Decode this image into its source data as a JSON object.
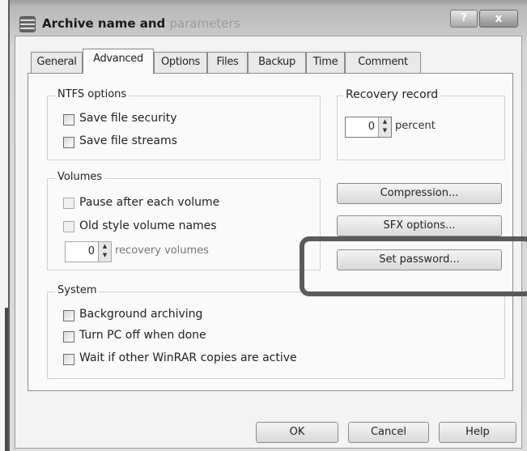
{
  "window": {
    "title_main": "Archive name and",
    "title_faded": "parameters",
    "help_label": "?",
    "close_label": "x"
  },
  "tabs": [
    {
      "label": "General",
      "active": false
    },
    {
      "label": "Advanced",
      "active": true
    },
    {
      "label": "Options",
      "active": false
    },
    {
      "label": "Files",
      "active": false
    },
    {
      "label": "Backup",
      "active": false
    },
    {
      "label": "Time",
      "active": false
    },
    {
      "label": "Comment",
      "active": false
    }
  ],
  "ntfs": {
    "title": "NTFS options",
    "options": [
      {
        "label": "Save file security",
        "checked": false
      },
      {
        "label": "Save file streams",
        "checked": false
      }
    ]
  },
  "recovery": {
    "title": "Recovery record",
    "value": "0",
    "unit": "percent"
  },
  "volumes": {
    "title": "Volumes",
    "options": [
      {
        "label": "Pause after each volume",
        "checked": false,
        "enabled": false
      },
      {
        "label": "Old style volume names",
        "checked": false,
        "enabled": false
      }
    ],
    "recovery_value": "0",
    "recovery_unit": "recovery volumes"
  },
  "buttons": {
    "compression": "Compression...",
    "sfx": "SFX options...",
    "password": "Set password..."
  },
  "system": {
    "title": "System",
    "options": [
      {
        "label": "Background archiving",
        "checked": false
      },
      {
        "label": "Turn PC off when done",
        "checked": false
      },
      {
        "label": "Wait if other WinRAR copies are active",
        "checked": false
      }
    ]
  },
  "footer": {
    "ok": "OK",
    "cancel": "Cancel",
    "help": "Help"
  }
}
